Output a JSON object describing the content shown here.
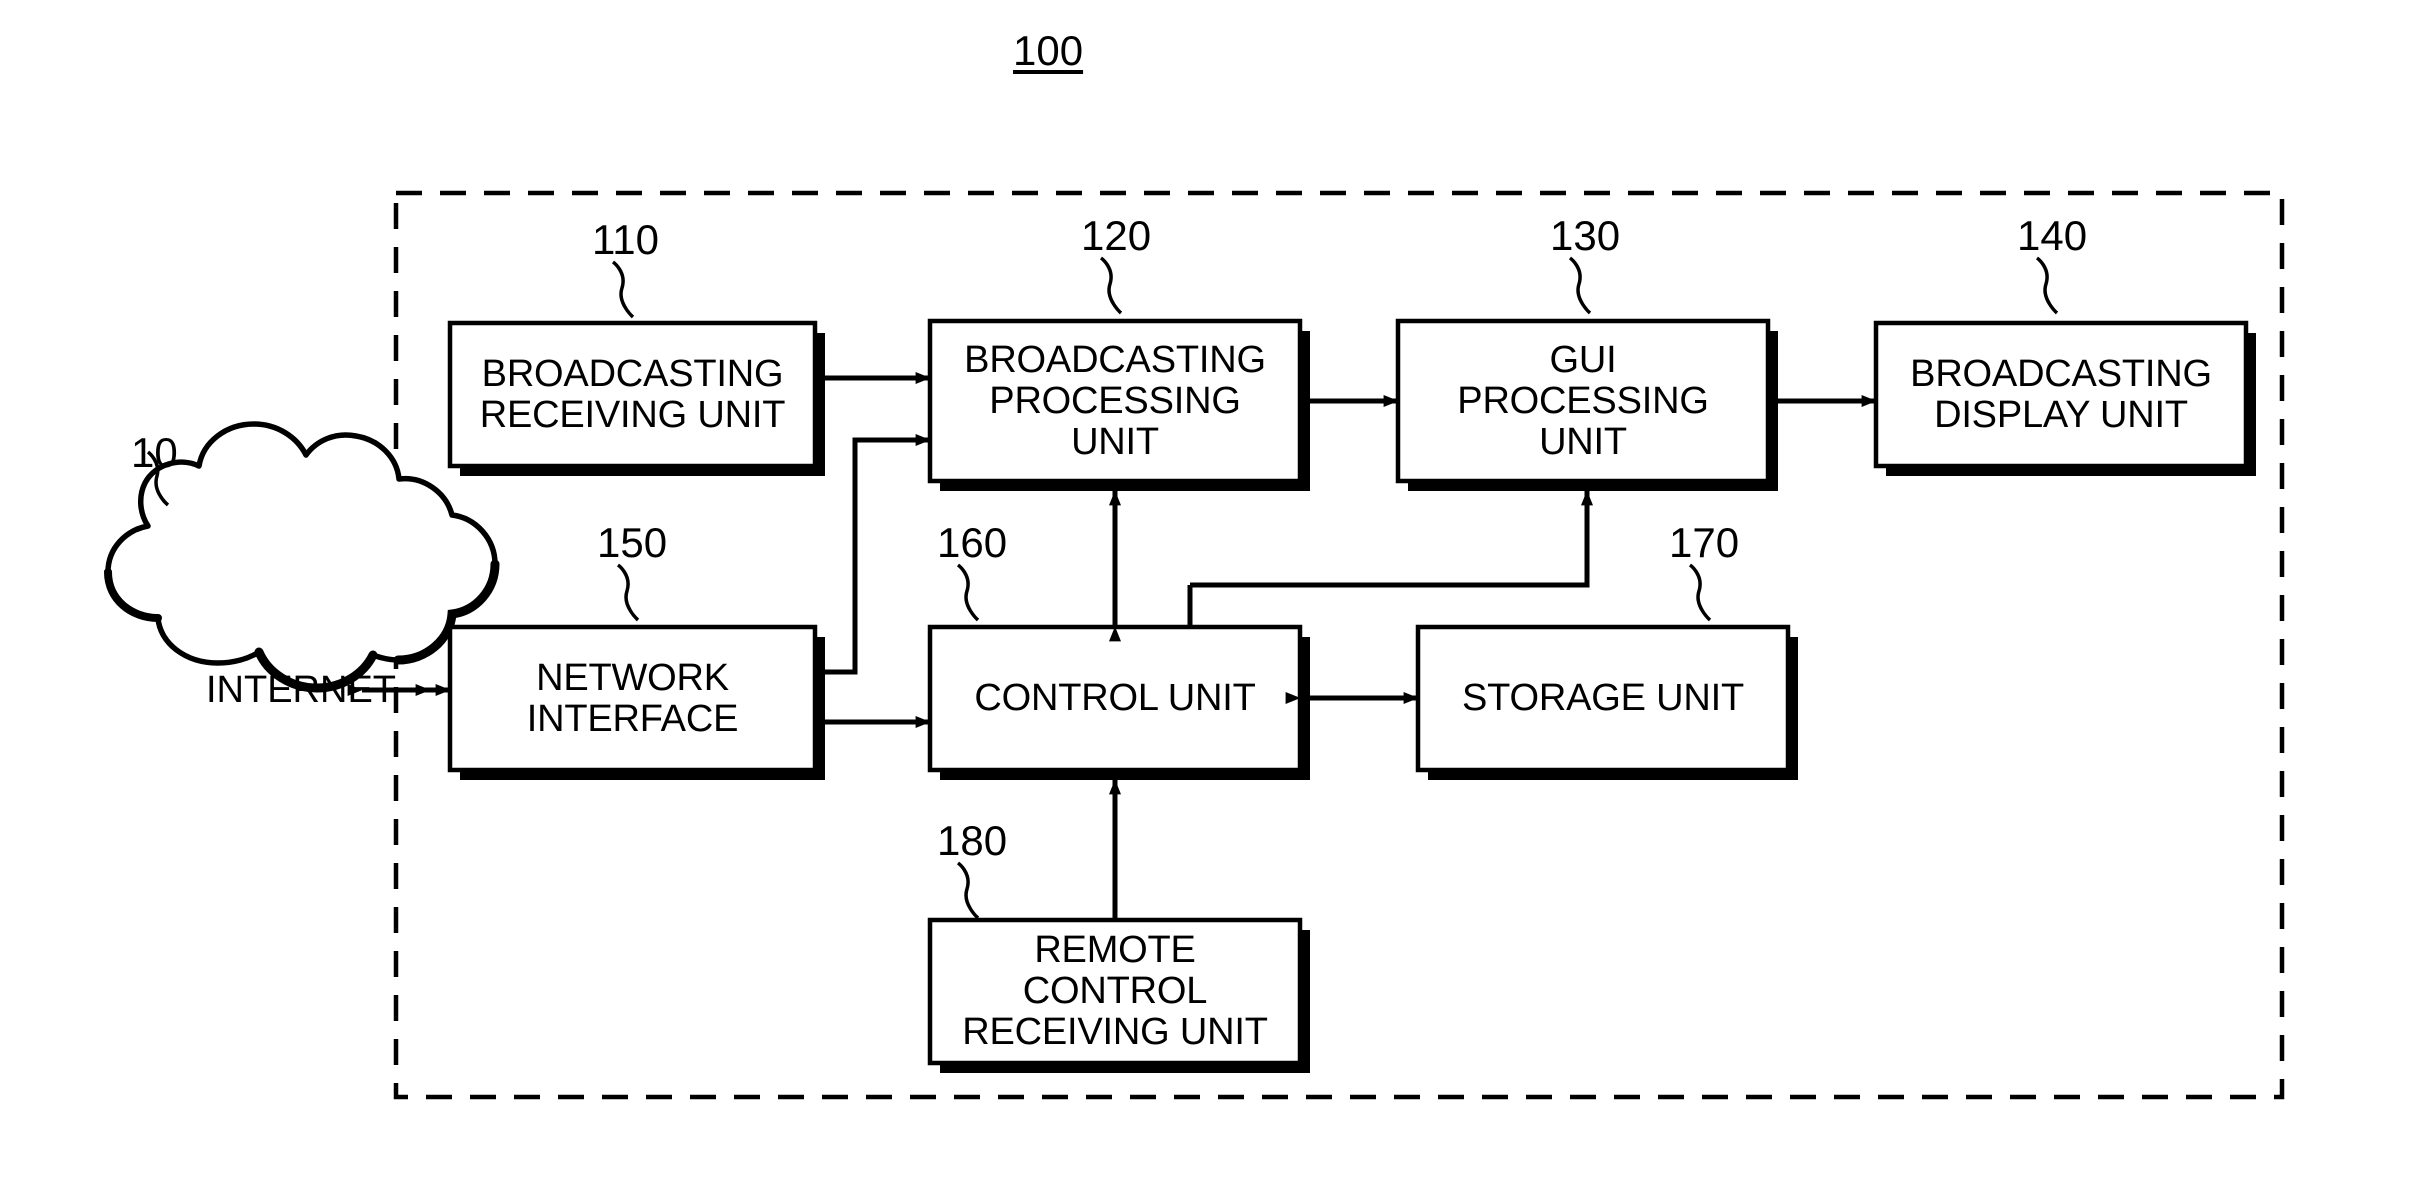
{
  "figure": {
    "system_ref": "100",
    "external_ref": "10",
    "external_node_label": "INTERNET"
  },
  "blocks": [
    {
      "id": "broadcasting_receiving_unit",
      "ref": "110",
      "lines": [
        "BROADCASTING",
        "RECEIVING UNIT"
      ]
    },
    {
      "id": "broadcasting_processing_unit",
      "ref": "120",
      "lines": [
        "BROADCASTING",
        "PROCESSING",
        "UNIT"
      ]
    },
    {
      "id": "gui_processing_unit",
      "ref": "130",
      "lines": [
        "GUI",
        "PROCESSING",
        "UNIT"
      ]
    },
    {
      "id": "broadcasting_display_unit",
      "ref": "140",
      "lines": [
        "BROADCASTING",
        "DISPLAY UNIT"
      ]
    },
    {
      "id": "network_interface",
      "ref": "150",
      "lines": [
        "NETWORK",
        "INTERFACE"
      ]
    },
    {
      "id": "control_unit",
      "ref": "160",
      "lines": [
        "CONTROL UNIT"
      ]
    },
    {
      "id": "storage_unit",
      "ref": "170",
      "lines": [
        "STORAGE UNIT"
      ]
    },
    {
      "id": "remote_control_receiving_unit",
      "ref": "180",
      "lines": [
        "REMOTE",
        "CONTROL",
        "RECEIVING UNIT"
      ]
    }
  ],
  "colors": {
    "line": "#000000",
    "background": "#ffffff"
  }
}
